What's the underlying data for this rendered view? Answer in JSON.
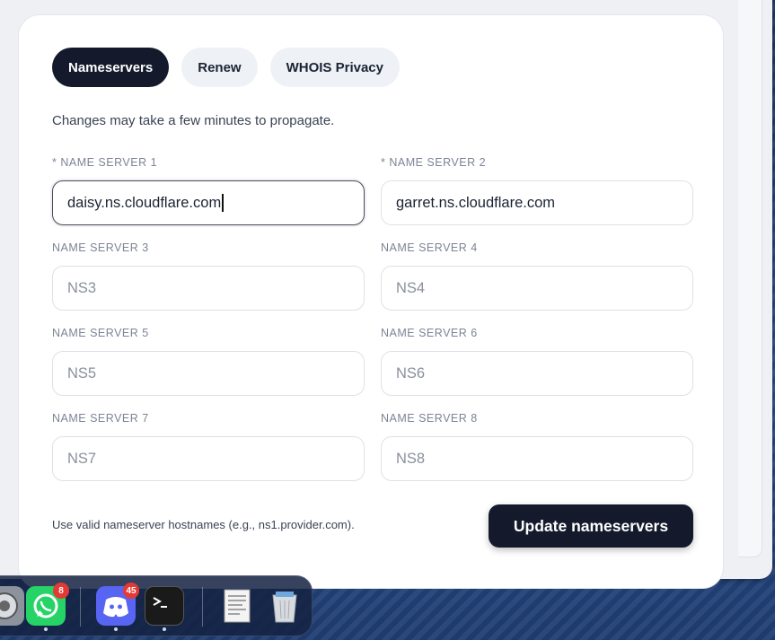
{
  "tabs": [
    {
      "label": "Nameservers",
      "active": true
    },
    {
      "label": "Renew",
      "active": false
    },
    {
      "label": "WHOIS Privacy",
      "active": false
    }
  ],
  "hint": "Changes may take a few minutes to propagate.",
  "fields": [
    {
      "label": "* NAME SERVER 1",
      "value": "daisy.ns.cloudflare.com",
      "placeholder": ""
    },
    {
      "label": "* NAME SERVER 2",
      "value": "garret.ns.cloudflare.com",
      "placeholder": ""
    },
    {
      "label": "NAME SERVER 3",
      "value": "",
      "placeholder": "NS3"
    },
    {
      "label": "NAME SERVER 4",
      "value": "",
      "placeholder": "NS4"
    },
    {
      "label": "NAME SERVER 5",
      "value": "",
      "placeholder": "NS5"
    },
    {
      "label": "NAME SERVER 6",
      "value": "",
      "placeholder": "NS6"
    },
    {
      "label": "NAME SERVER 7",
      "value": "",
      "placeholder": "NS7"
    },
    {
      "label": "NAME SERVER 8",
      "value": "",
      "placeholder": "NS8"
    }
  ],
  "footnote": "Use valid nameserver hostnames (e.g., ns1.provider.com).",
  "submit_label": "Update nameservers",
  "dock": {
    "items": [
      {
        "name": "system-settings-icon",
        "badge": ""
      },
      {
        "name": "whatsapp-icon",
        "badge": "8"
      },
      {
        "name": "discord-icon",
        "badge": "45"
      },
      {
        "name": "terminal-icon",
        "badge": ""
      },
      {
        "name": "document-icon",
        "badge": ""
      },
      {
        "name": "trash-icon",
        "badge": ""
      }
    ]
  },
  "colors": {
    "primary": "#141a2b",
    "badge": "#e53935",
    "whatsapp": "#25d366",
    "discord": "#5865f2"
  }
}
